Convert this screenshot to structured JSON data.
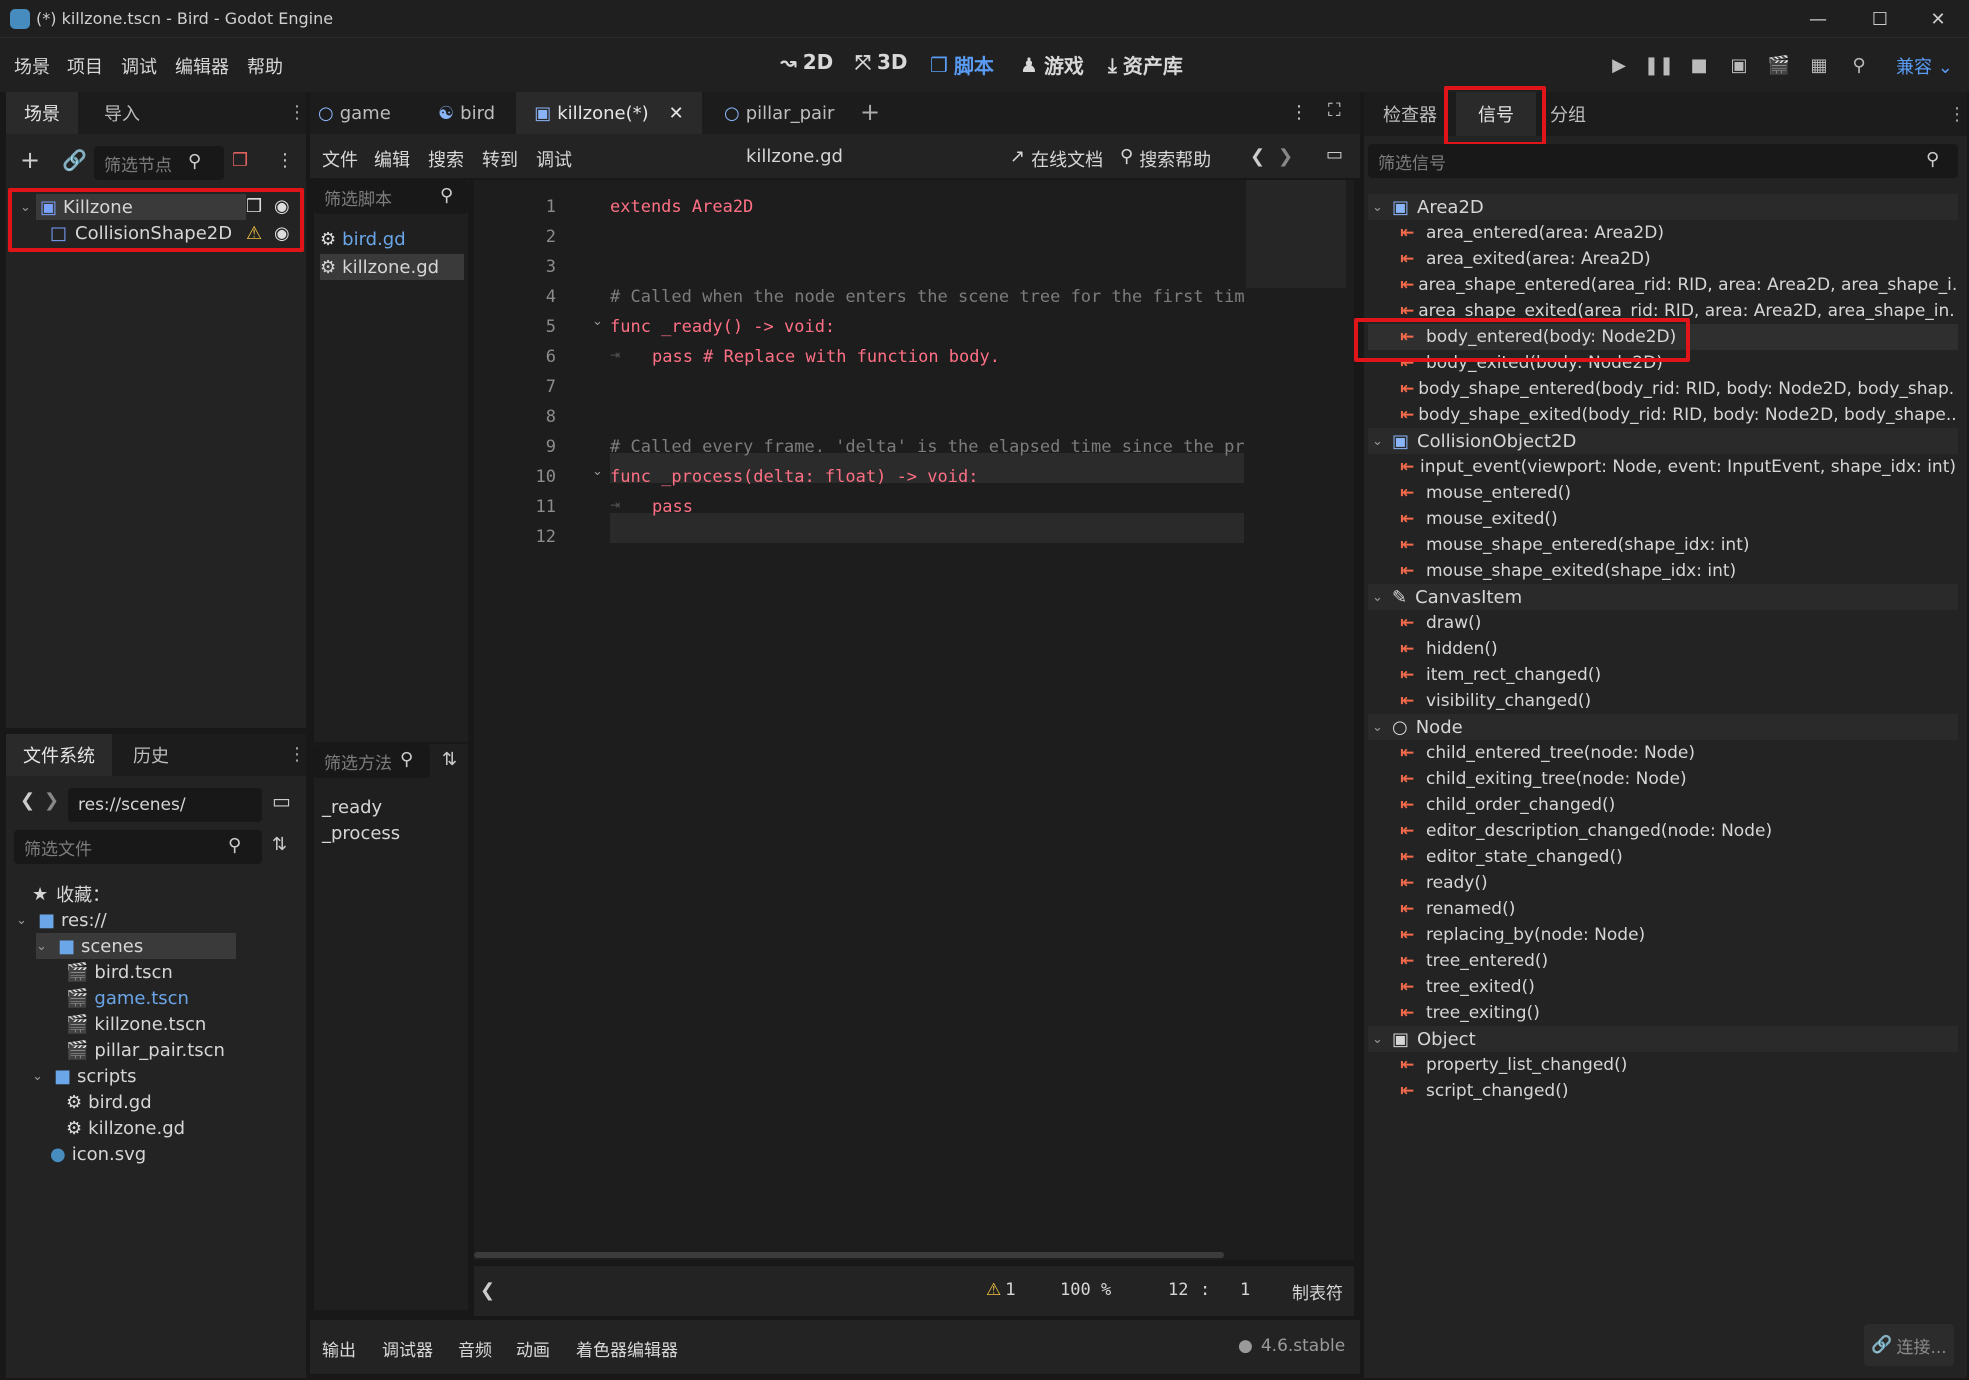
{
  "window": {
    "title": "(*) killzone.tscn - Bird - Godot Engine"
  },
  "menus": [
    "场景",
    "项目",
    "调试",
    "编辑器",
    "帮助"
  ],
  "workspaces": [
    {
      "label": "2D",
      "active": false
    },
    {
      "label": "3D",
      "active": false
    },
    {
      "label": "脚本",
      "active": true
    },
    {
      "label": "游戏",
      "active": false
    },
    {
      "label": "资产库",
      "active": false
    }
  ],
  "renderer": "兼容",
  "scene_dock": {
    "tabs": [
      "场景",
      "导入"
    ],
    "filter_placeholder": "筛选节点",
    "nodes": [
      {
        "name": "Killzone",
        "icon": "area2d-icon"
      },
      {
        "name": "CollisionShape2D",
        "icon": "collisionshape-icon"
      }
    ]
  },
  "filesystem": {
    "tabs": [
      "文件系统",
      "历史"
    ],
    "path": "res://scenes/",
    "filter_placeholder": "筛选文件",
    "favorites": "收藏：",
    "root": "res://",
    "items": [
      {
        "name": "scenes",
        "type": "folder",
        "depth": 1
      },
      {
        "name": "bird.tscn",
        "type": "scene",
        "depth": 2
      },
      {
        "name": "game.tscn",
        "type": "scene",
        "depth": 2
      },
      {
        "name": "killzone.tscn",
        "type": "scene",
        "depth": 2
      },
      {
        "name": "pillar_pair.tscn",
        "type": "scene",
        "depth": 2
      },
      {
        "name": "scripts",
        "type": "folder",
        "depth": 1
      },
      {
        "name": "bird.gd",
        "type": "script",
        "depth": 2
      },
      {
        "name": "killzone.gd",
        "type": "script",
        "depth": 2
      },
      {
        "name": "icon.svg",
        "type": "image",
        "depth": 1
      }
    ]
  },
  "scene_tabs": [
    "game",
    "bird",
    "killzone(*)",
    "pillar_pair"
  ],
  "script_editor": {
    "menus": [
      "文件",
      "编辑",
      "搜索",
      "转到",
      "调试"
    ],
    "current_file": "killzone.gd",
    "online_docs": "在线文档",
    "search_help": "搜索帮助",
    "script_filter_placeholder": "筛选脚本",
    "scripts": [
      "bird.gd",
      "killzone.gd"
    ],
    "method_filter_placeholder": "筛选方法",
    "methods": [
      "_ready",
      "_process"
    ],
    "code": [
      {
        "n": "1",
        "text": "extends Area2D"
      },
      {
        "n": "2",
        "text": ""
      },
      {
        "n": "3",
        "text": ""
      },
      {
        "n": "4",
        "text": "# Called when the node enters the scene tree for the first tim"
      },
      {
        "n": "5",
        "text": "func _ready() -> void:"
      },
      {
        "n": "6",
        "text": "pass # Replace with function body."
      },
      {
        "n": "7",
        "text": ""
      },
      {
        "n": "8",
        "text": ""
      },
      {
        "n": "9",
        "text": "# Called every frame. 'delta' is the elapsed time since the pr"
      },
      {
        "n": "10",
        "text": "func _process(delta: float) -> void:"
      },
      {
        "n": "11",
        "text": "pass"
      },
      {
        "n": "12",
        "text": ""
      }
    ],
    "status": {
      "warnings": "1",
      "zoom": "100 %",
      "line": "12",
      "sep": ":",
      "col": "1",
      "indent": "制表符"
    }
  },
  "bottom_tabs": [
    "输出",
    "调试器",
    "音频",
    "动画",
    "着色器编辑器"
  ],
  "version": "4.6.stable",
  "inspector": {
    "tabs": [
      "检查器",
      "信号",
      "分组"
    ],
    "filter_placeholder": "筛选信号",
    "groups": [
      {
        "name": "Area2D",
        "signals": [
          "area_entered(area: Area2D)",
          "area_exited(area: Area2D)",
          "area_shape_entered(area_rid: RID, area: Area2D, area_shape_i...",
          "area_shape_exited(area_rid: RID, area: Area2D, area_shape_in...",
          "body_entered(body: Node2D)",
          "body_exited(body: Node2D)",
          "body_shape_entered(body_rid: RID, body: Node2D, body_shap...",
          "body_shape_exited(body_rid: RID, body: Node2D, body_shape..."
        ]
      },
      {
        "name": "CollisionObject2D",
        "signals": [
          "input_event(viewport: Node, event: InputEvent, shape_idx: int)",
          "mouse_entered()",
          "mouse_exited()",
          "mouse_shape_entered(shape_idx: int)",
          "mouse_shape_exited(shape_idx: int)"
        ]
      },
      {
        "name": "CanvasItem",
        "signals": [
          "draw()",
          "hidden()",
          "item_rect_changed()",
          "visibility_changed()"
        ]
      },
      {
        "name": "Node",
        "signals": [
          "child_entered_tree(node: Node)",
          "child_exiting_tree(node: Node)",
          "child_order_changed()",
          "editor_description_changed(node: Node)",
          "editor_state_changed()",
          "ready()",
          "renamed()",
          "replacing_by(node: Node)",
          "tree_entered()",
          "tree_exited()",
          "tree_exiting()"
        ]
      },
      {
        "name": "Object",
        "signals": [
          "property_list_changed()",
          "script_changed()"
        ]
      }
    ],
    "connect_button": "连接..."
  }
}
